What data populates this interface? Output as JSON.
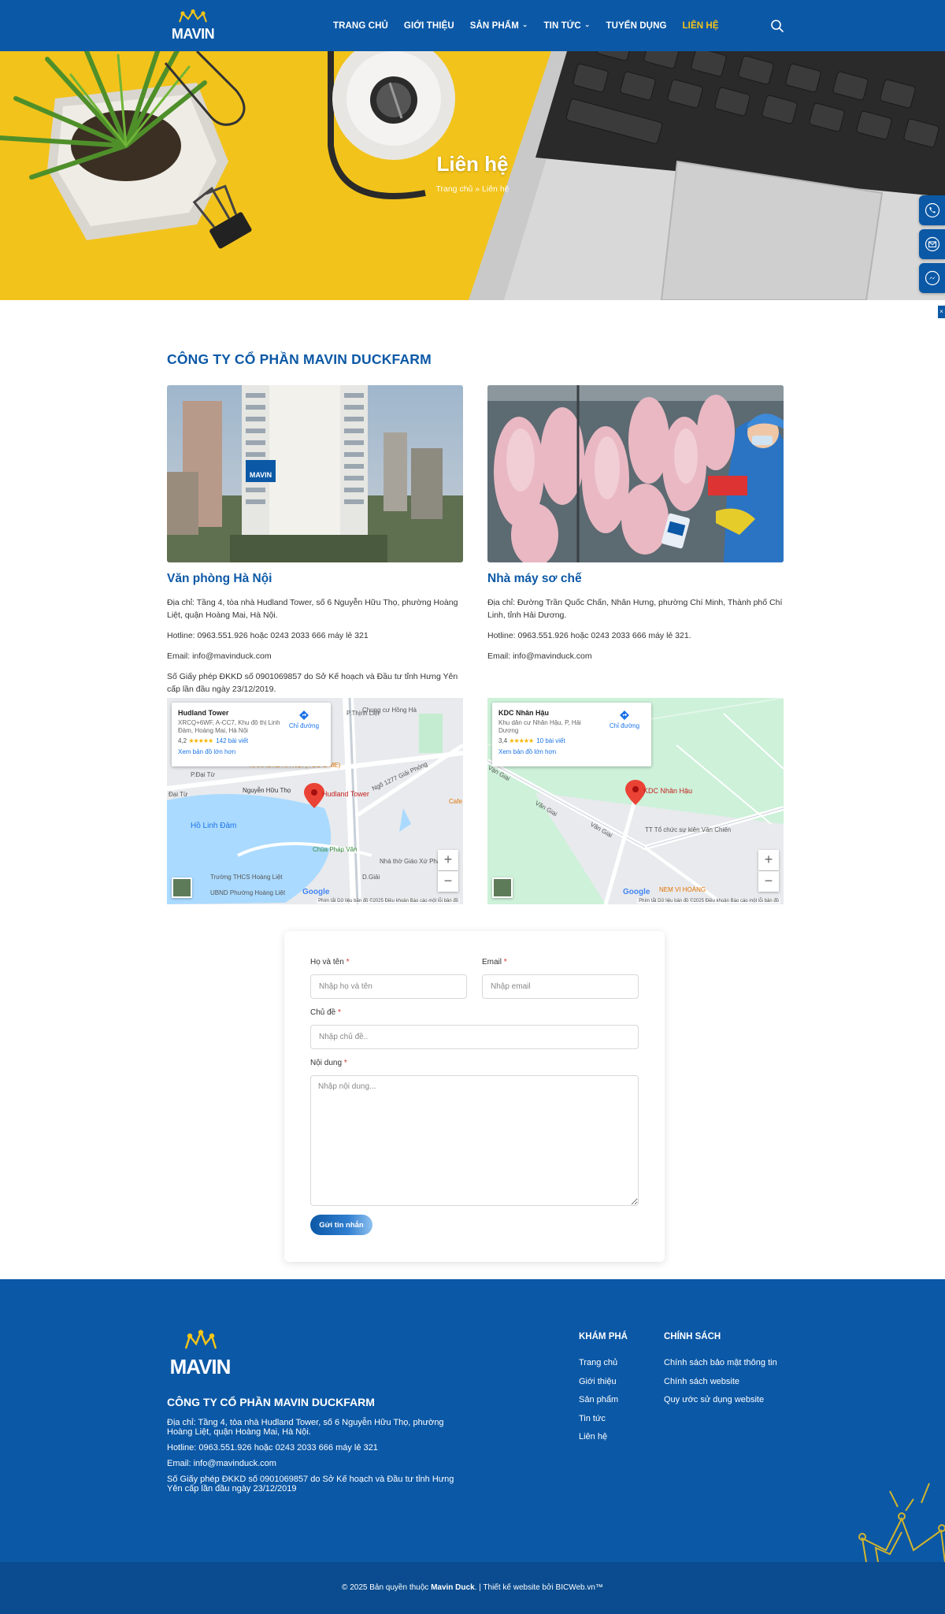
{
  "header": {
    "logo_text": "MAVIN",
    "nav": [
      {
        "label": "TRANG CHỦ",
        "has_dropdown": false,
        "active": false
      },
      {
        "label": "GIỚI THIỆU",
        "has_dropdown": false,
        "active": false
      },
      {
        "label": "SẢN PHẨM",
        "has_dropdown": true,
        "active": false
      },
      {
        "label": "TIN TỨC",
        "has_dropdown": true,
        "active": false
      },
      {
        "label": "TUYỂN DỤNG",
        "has_dropdown": false,
        "active": false
      },
      {
        "label": "LIÊN HỆ",
        "has_dropdown": false,
        "active": true
      }
    ],
    "icons": {
      "search": "search-icon",
      "dropdown": "chevron-down-icon"
    }
  },
  "hero": {
    "title": "Liên hệ",
    "breadcrumb": "Trang chủ » Liên hệ"
  },
  "side_buttons": [
    "phone-icon",
    "email-icon",
    "messenger-icon"
  ],
  "company_title": "CÔNG TY CỔ PHẦN MAVIN DUCKFARM",
  "locations": [
    {
      "title": "Văn phòng Hà Nội",
      "address": "Địa chỉ: Tầng 4, tòa nhà Hudland Tower, số 6 Nguyễn Hữu Thọ, phường Hoàng Liệt, quận Hoàng Mai, Hà Nội.",
      "hotline": "Hotline: 0963.551.926 hoặc 0243 2033 666 máy lẻ 321",
      "email": "Email: info@mavinduck.com",
      "license": "Số Giấy phép ĐKKD số 0901069857 do Sở Kế hoạch và Đầu tư tỉnh Hưng Yên cấp lần đầu ngày 23/12/2019.",
      "map": {
        "place": "Hudland Tower",
        "address": "XRCQ+6WF, A-CC7, Khu đô thị Linh Đàm, Hoàng Mai, Hà Nội",
        "rating": "4,2",
        "stars": "★★★★★",
        "reviews": "142 bài viết",
        "directions": "Chỉ đường",
        "larger_map": "Xem bản đồ lớn hơn",
        "pin_label": "Hudland Tower",
        "labels": [
          "Chung cư Hồng Hà",
          "P.Thịnh Liệt",
          "KARAOKE HÀ NỘI (YOU & ME)",
          "Nguyễn Hữu Thọ",
          "Hồ Linh Đàm",
          "Chùa Pháp Vân",
          "Nhà thờ Giáo Xứ Pháp Vân",
          "Trường THCS Hoàng Liệt",
          "UBND Phường Hoàng Liệt",
          "Ngõ 1277 Giải Phóng",
          "Cafe",
          "P.Đại Từ",
          "Đại Từ",
          "D.Giải"
        ]
      }
    },
    {
      "title": "Nhà máy sơ chế",
      "address": "Địa chỉ: Đường Trần Quốc Chấn, Nhân Hưng, phường Chí Minh, Thành phố Chí Linh, tỉnh Hải Dương.",
      "hotline": "Hotline: 0963.551.926 hoặc 0243 2033 666 máy lẻ 321.",
      "email": "Email: info@mavinduck.com",
      "license": "",
      "map": {
        "place": "KDC Nhân Hậu",
        "address": "Khu dân cư Nhân Hậu, P, Hải Dương",
        "rating": "3,4",
        "stars": "★★★★★",
        "reviews": "10 bài viết",
        "directions": "Chỉ đường",
        "larger_map": "Xem bản đồ lớn hơn",
        "pin_label": "KDC Nhân Hậu",
        "labels": [
          "Vạn Giai",
          "Văn Giai",
          "Vân Giai",
          "TT Tổ chức sự kiện Văn Chiến",
          "NEM VI HOÀNG"
        ]
      }
    }
  ],
  "map_common": {
    "google": "Google",
    "footer": "Phím tắt   Dữ liệu bản đồ ©2025   Điều khoản   Báo cáo một lỗi bản đồ",
    "zoom_in": "+",
    "zoom_out": "−"
  },
  "form": {
    "name_label": "Họ và tên",
    "name_placeholder": "Nhập họ và tên",
    "email_label": "Email",
    "email_placeholder": "Nhập email",
    "subject_label": "Chủ đề",
    "subject_placeholder": "Nhập chủ đề..",
    "message_label": "Nội dung",
    "message_placeholder": "Nhập nội dung...",
    "required_mark": "*",
    "submit": "Gửi tin nhắn"
  },
  "footer": {
    "logo_text": "MAVIN",
    "company": "CÔNG TY CỔ PHẦN MAVIN DUCKFARM",
    "address": "Địa chỉ: Tầng 4, tòa nhà Hudland Tower, số 6 Nguyễn Hữu Thọ, phường Hoàng Liệt, quận Hoàng Mai, Hà Nội.",
    "hotline": "Hotline: 0963.551.926 hoặc 0243 2033 666 máy lẻ 321",
    "email": "Email: info@mavinduck.com",
    "license": "Số Giấy phép ĐKKD số 0901069857 do Sở Kế hoạch và Đầu tư tỉnh Hưng Yên cấp lần đầu ngày 23/12/2019",
    "explore_title": "KHÁM PHÁ",
    "explore_links": [
      "Trang chủ",
      "Giới thiệu",
      "Sản phẩm",
      "Tin tức",
      "Liên hệ"
    ],
    "policy_title": "CHÍNH SÁCH",
    "policy_links": [
      "Chính sách bảo mật thông tin",
      "Chính sách website",
      "Quy ước sử dụng website"
    ]
  },
  "copyright": {
    "prefix": "© 2025 Bản quyền thuộc ",
    "brand": "Mavin Duck",
    "suffix": ". | Thiết kế website bởi BICWeb.vn™"
  },
  "colors": {
    "brand_blue": "#0b58a6",
    "accent_yellow": "#f5c518",
    "hero_yellow": "#f2c31b",
    "copyright_bar": "#0a4c8f"
  }
}
